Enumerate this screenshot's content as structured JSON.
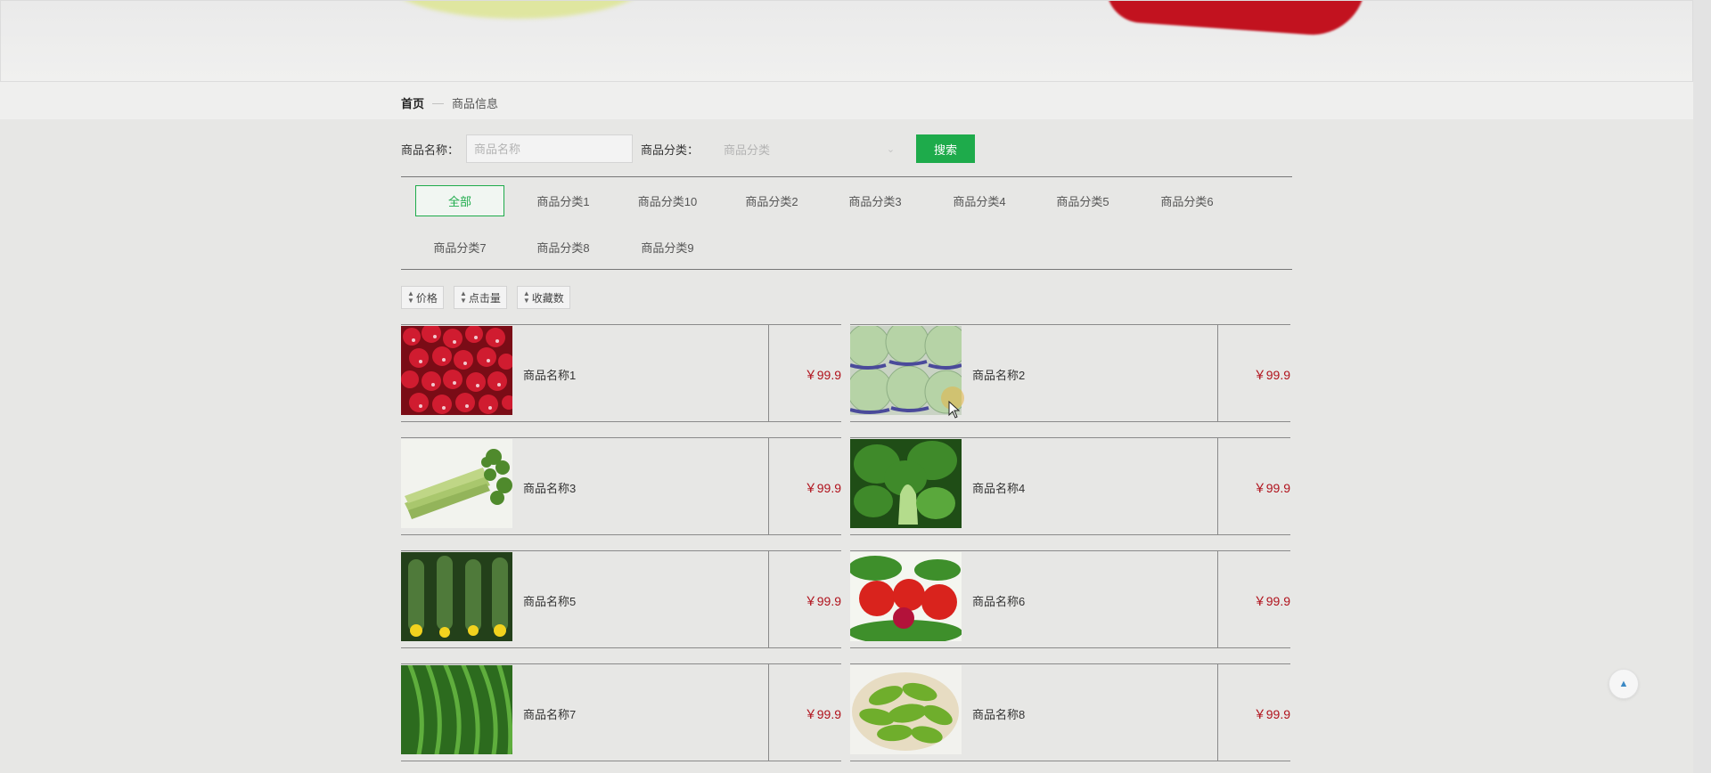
{
  "breadcrumb": {
    "home": "首页",
    "separator": "—",
    "current": "商品信息"
  },
  "search": {
    "name_label": "商品名称：",
    "name_placeholder": "商品名称",
    "name_value": "",
    "category_label": "商品分类：",
    "category_placeholder": "商品分类",
    "button_label": "搜索",
    "button_color": "#1eab4b"
  },
  "categories": [
    {
      "label": "全部",
      "active": true
    },
    {
      "label": "商品分类1"
    },
    {
      "label": "商品分类10"
    },
    {
      "label": "商品分类2"
    },
    {
      "label": "商品分类3"
    },
    {
      "label": "商品分类4"
    },
    {
      "label": "商品分类5"
    },
    {
      "label": "商品分类6"
    },
    {
      "label": "商品分类7"
    },
    {
      "label": "商品分类8"
    },
    {
      "label": "商品分类9"
    }
  ],
  "sort_buttons": [
    {
      "label": "价格",
      "icon": "sort-icon"
    },
    {
      "label": "点击量",
      "icon": "sort-icon"
    },
    {
      "label": "收藏数",
      "icon": "sort-icon"
    }
  ],
  "products": [
    {
      "name": "商品名称1",
      "price": "￥99.9",
      "image": "radish"
    },
    {
      "name": "商品名称2",
      "price": "￥99.9",
      "image": "cabbage"
    },
    {
      "name": "商品名称3",
      "price": "￥99.9",
      "image": "celery"
    },
    {
      "name": "商品名称4",
      "price": "￥99.9",
      "image": "bok-choy"
    },
    {
      "name": "商品名称5",
      "price": "￥99.9",
      "image": "loofah"
    },
    {
      "name": "商品名称6",
      "price": "￥99.9",
      "image": "tomato-radish"
    },
    {
      "name": "商品名称7",
      "price": "￥99.9",
      "image": "green-beans"
    },
    {
      "name": "商品名称8",
      "price": "￥99.9",
      "image": "edamame"
    }
  ],
  "colors": {
    "accent": "#1eab4b",
    "price": "#b0121c",
    "background": "#e7e7e5"
  },
  "back_to_top_icon": "arrow-up-icon"
}
